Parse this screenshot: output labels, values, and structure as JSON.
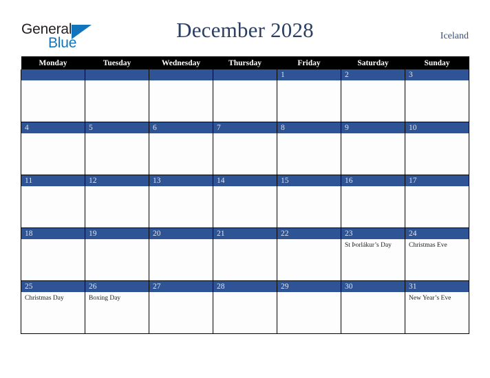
{
  "brand": {
    "name_part1": "General",
    "name_part2": "Blue",
    "triangle_color": "#1275bc",
    "text_color": "#231f20"
  },
  "header": {
    "title": "December 2028",
    "country": "Iceland",
    "title_color": "#2b3f63"
  },
  "calendar": {
    "weekday_headers": [
      "Monday",
      "Tuesday",
      "Wednesday",
      "Thursday",
      "Friday",
      "Saturday",
      "Sunday"
    ],
    "header_bg": "#000000",
    "daybar_bg": "#2e5496",
    "cell_bg": "#fdfdfd",
    "weeks": [
      [
        {
          "day": "",
          "holiday": ""
        },
        {
          "day": "",
          "holiday": ""
        },
        {
          "day": "",
          "holiday": ""
        },
        {
          "day": "",
          "holiday": ""
        },
        {
          "day": "1",
          "holiday": ""
        },
        {
          "day": "2",
          "holiday": ""
        },
        {
          "day": "3",
          "holiday": ""
        }
      ],
      [
        {
          "day": "4",
          "holiday": ""
        },
        {
          "day": "5",
          "holiday": ""
        },
        {
          "day": "6",
          "holiday": ""
        },
        {
          "day": "7",
          "holiday": ""
        },
        {
          "day": "8",
          "holiday": ""
        },
        {
          "day": "9",
          "holiday": ""
        },
        {
          "day": "10",
          "holiday": ""
        }
      ],
      [
        {
          "day": "11",
          "holiday": ""
        },
        {
          "day": "12",
          "holiday": ""
        },
        {
          "day": "13",
          "holiday": ""
        },
        {
          "day": "14",
          "holiday": ""
        },
        {
          "day": "15",
          "holiday": ""
        },
        {
          "day": "16",
          "holiday": ""
        },
        {
          "day": "17",
          "holiday": ""
        }
      ],
      [
        {
          "day": "18",
          "holiday": ""
        },
        {
          "day": "19",
          "holiday": ""
        },
        {
          "day": "20",
          "holiday": ""
        },
        {
          "day": "21",
          "holiday": ""
        },
        {
          "day": "22",
          "holiday": ""
        },
        {
          "day": "23",
          "holiday": "St Þorlákur’s Day"
        },
        {
          "day": "24",
          "holiday": "Christmas Eve"
        }
      ],
      [
        {
          "day": "25",
          "holiday": "Christmas Day"
        },
        {
          "day": "26",
          "holiday": "Boxing Day"
        },
        {
          "day": "27",
          "holiday": ""
        },
        {
          "day": "28",
          "holiday": ""
        },
        {
          "day": "29",
          "holiday": ""
        },
        {
          "day": "30",
          "holiday": ""
        },
        {
          "day": "31",
          "holiday": "New Year’s Eve"
        }
      ]
    ]
  }
}
